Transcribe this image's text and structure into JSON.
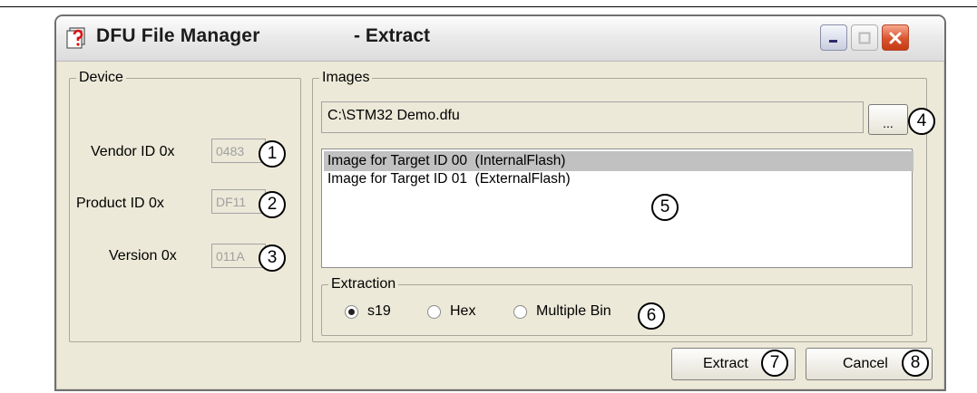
{
  "window": {
    "title": "DFU File Manager",
    "subtitle": "- Extract"
  },
  "device": {
    "group_title": "Device",
    "fields": [
      {
        "label": "Vendor ID 0x",
        "value": "0483",
        "callout": "1"
      },
      {
        "label": "Product ID 0x",
        "value": "DF11",
        "callout": "2"
      },
      {
        "label": "Version 0x",
        "value": "011A",
        "callout": "3"
      }
    ]
  },
  "images": {
    "group_title": "Images",
    "path": "C:\\STM32 Demo.dfu",
    "browse_label": "...",
    "browse_callout": "4",
    "list_items": [
      "Image for Target ID 00  (InternalFlash)",
      "Image for Target ID 01  (ExternalFlash)"
    ],
    "selected_index": 0,
    "list_callout": "5"
  },
  "extraction": {
    "group_title": "Extraction",
    "options": [
      "s19",
      "Hex",
      "Multiple Bin"
    ],
    "selected": "s19",
    "callout": "6"
  },
  "buttons": {
    "extract_label": "Extract",
    "extract_callout": "7",
    "cancel_label": "Cancel",
    "cancel_callout": "8"
  }
}
